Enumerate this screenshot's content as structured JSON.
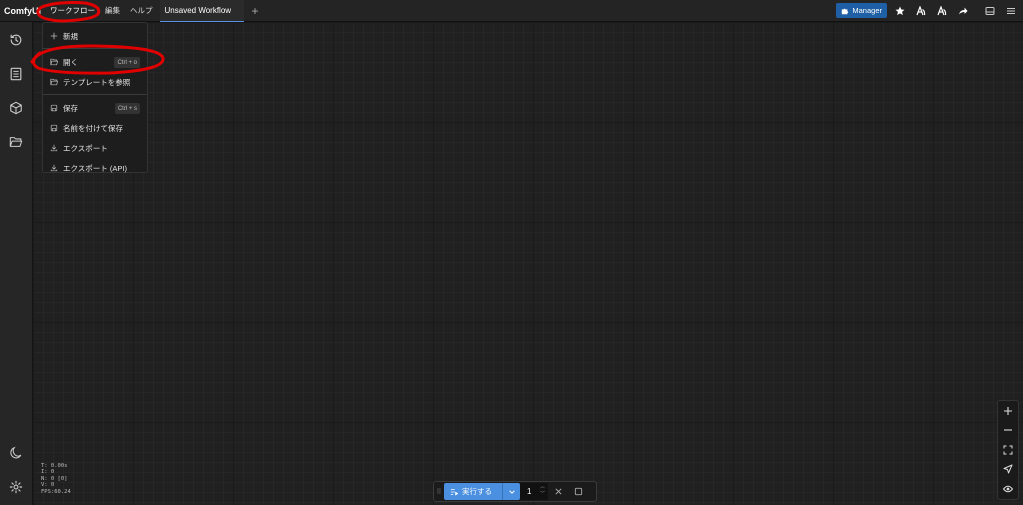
{
  "topbar": {
    "logo": "ComfyUI",
    "menus": [
      "ワークフロー",
      "編集",
      "ヘルプ"
    ],
    "tab_title": "Unsaved Workflow",
    "add_tab": "+",
    "manager_label": "Manager"
  },
  "dropdown": {
    "items": [
      {
        "label": "新規",
        "icon": "plus-icon",
        "shortcut": ""
      },
      {
        "label": "開く",
        "icon": "folder-open-icon",
        "shortcut": "Ctrl + o"
      },
      {
        "label": "テンプレートを参照",
        "icon": "folder-open-icon",
        "shortcut": ""
      },
      {
        "label": "保存",
        "icon": "save-icon",
        "shortcut": "Ctrl + s"
      },
      {
        "label": "名前を付けて保存",
        "icon": "save-icon",
        "shortcut": ""
      },
      {
        "label": "エクスポート",
        "icon": "download-icon",
        "shortcut": ""
      },
      {
        "label": "エクスポート (API)",
        "icon": "download-icon",
        "shortcut": ""
      }
    ]
  },
  "sidebar": {
    "icons": [
      "history-icon",
      "document-list-icon",
      "cube-icon",
      "folder-icon",
      "moon-icon",
      "gear-icon"
    ]
  },
  "stats": {
    "t": "T: 0.00s",
    "i": "I: 0",
    "n": "N: 0 [0]",
    "v": "V: 0",
    "fps": "FPS:60.24"
  },
  "runbar": {
    "run_label": "実行する",
    "count": "1"
  },
  "colors": {
    "accent": "#4a8fe0",
    "manager": "#1f5fa5",
    "annotation": "#e00000",
    "background": "#202020"
  }
}
